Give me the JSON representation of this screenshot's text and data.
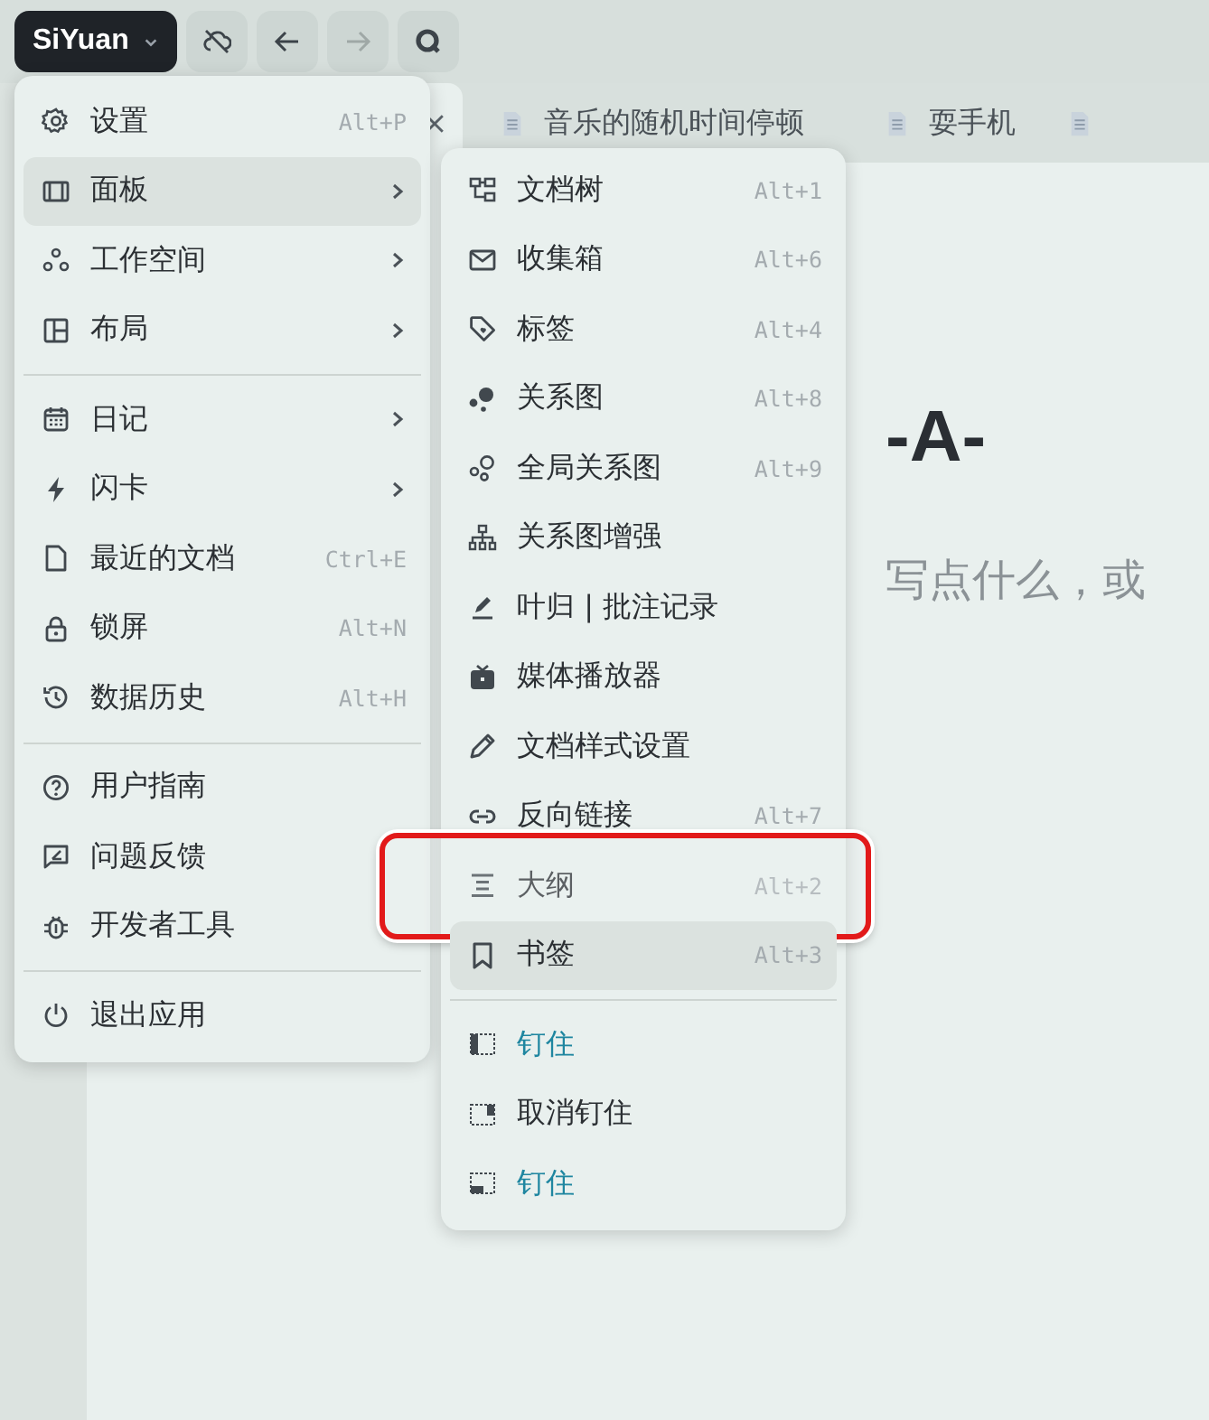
{
  "toolbar": {
    "app_button": "SiYuan",
    "buttons": [
      {
        "kind": "sync",
        "disabled": false
      },
      {
        "kind": "back",
        "disabled": false
      },
      {
        "kind": "forward",
        "disabled": true
      },
      {
        "kind": "search",
        "disabled": false
      }
    ]
  },
  "tabs": [
    {
      "selected": true,
      "closable": true
    },
    {
      "label": "音乐的随机时间停顿",
      "selected": false,
      "closable": false
    },
    {
      "label": "耍手机",
      "selected": false,
      "closable": false
    },
    {
      "selected": false,
      "closable": false
    }
  ],
  "document": {
    "title": "-A-",
    "placeholder": "写点什么，或"
  },
  "main_menu": [
    {
      "kind": "item",
      "label": "设置",
      "shortcut": "Alt+P",
      "submenu": false,
      "selected": false
    },
    {
      "kind": "item",
      "label": "面板",
      "submenu": true,
      "selected": true
    },
    {
      "kind": "item",
      "label": "工作空间",
      "submenu": true,
      "selected": false
    },
    {
      "kind": "item",
      "label": "布局",
      "submenu": true,
      "selected": false
    },
    {
      "kind": "separator"
    },
    {
      "kind": "item",
      "label": "日记",
      "submenu": true,
      "selected": false
    },
    {
      "kind": "item",
      "label": "闪卡",
      "submenu": true,
      "selected": false
    },
    {
      "kind": "item",
      "label": "最近的文档",
      "shortcut": "Ctrl+E",
      "submenu": false,
      "selected": false
    },
    {
      "kind": "item",
      "label": "锁屏",
      "shortcut": "Alt+N",
      "submenu": false,
      "selected": false
    },
    {
      "kind": "item",
      "label": "数据历史",
      "shortcut": "Alt+H",
      "submenu": false,
      "selected": false
    },
    {
      "kind": "separator"
    },
    {
      "kind": "item",
      "label": "用户指南",
      "submenu": false,
      "selected": false
    },
    {
      "kind": "item",
      "label": "问题反馈",
      "submenu": false,
      "selected": false
    },
    {
      "kind": "item",
      "label": "开发者工具",
      "submenu": false,
      "selected": false
    },
    {
      "kind": "separator"
    },
    {
      "kind": "item",
      "label": "退出应用",
      "submenu": false,
      "selected": false
    }
  ],
  "panel_submenu": [
    {
      "kind": "item",
      "label": "文档树",
      "shortcut": "Alt+1",
      "selected": false,
      "outlined": false
    },
    {
      "kind": "item",
      "label": "收集箱",
      "shortcut": "Alt+6",
      "selected": false,
      "outlined": false
    },
    {
      "kind": "item",
      "label": "标签",
      "shortcut": "Alt+4",
      "selected": false,
      "outlined": false
    },
    {
      "kind": "item",
      "label": "关系图",
      "shortcut": "Alt+8",
      "selected": false,
      "outlined": false
    },
    {
      "kind": "item",
      "label": "全局关系图",
      "shortcut": "Alt+9",
      "selected": false,
      "outlined": false
    },
    {
      "kind": "item",
      "label": "关系图增强",
      "selected": false,
      "outlined": false
    },
    {
      "kind": "item",
      "label": "叶归 | 批注记录",
      "selected": false,
      "outlined": false
    },
    {
      "kind": "item",
      "label": "媒体播放器",
      "selected": false,
      "outlined": false
    },
    {
      "kind": "item",
      "label": "文档样式设置",
      "selected": false,
      "outlined": false
    },
    {
      "kind": "item",
      "label": "反向链接",
      "shortcut": "Alt+7",
      "selected": false,
      "outlined": false
    },
    {
      "kind": "item",
      "label": "大纲",
      "shortcut": "Alt+2",
      "selected": false,
      "outlined": true
    },
    {
      "kind": "item",
      "label": "书签",
      "shortcut": "Alt+3",
      "selected": true,
      "outlined": false
    },
    {
      "kind": "separator"
    },
    {
      "kind": "item",
      "label": "钉住",
      "selected": false,
      "outlined": false,
      "color": "#1f86a0"
    },
    {
      "kind": "item",
      "label": "取消钉住",
      "selected": false,
      "outlined": false
    },
    {
      "kind": "item",
      "label": "钉住",
      "selected": false,
      "outlined": false,
      "color": "#1f86a0"
    }
  ]
}
